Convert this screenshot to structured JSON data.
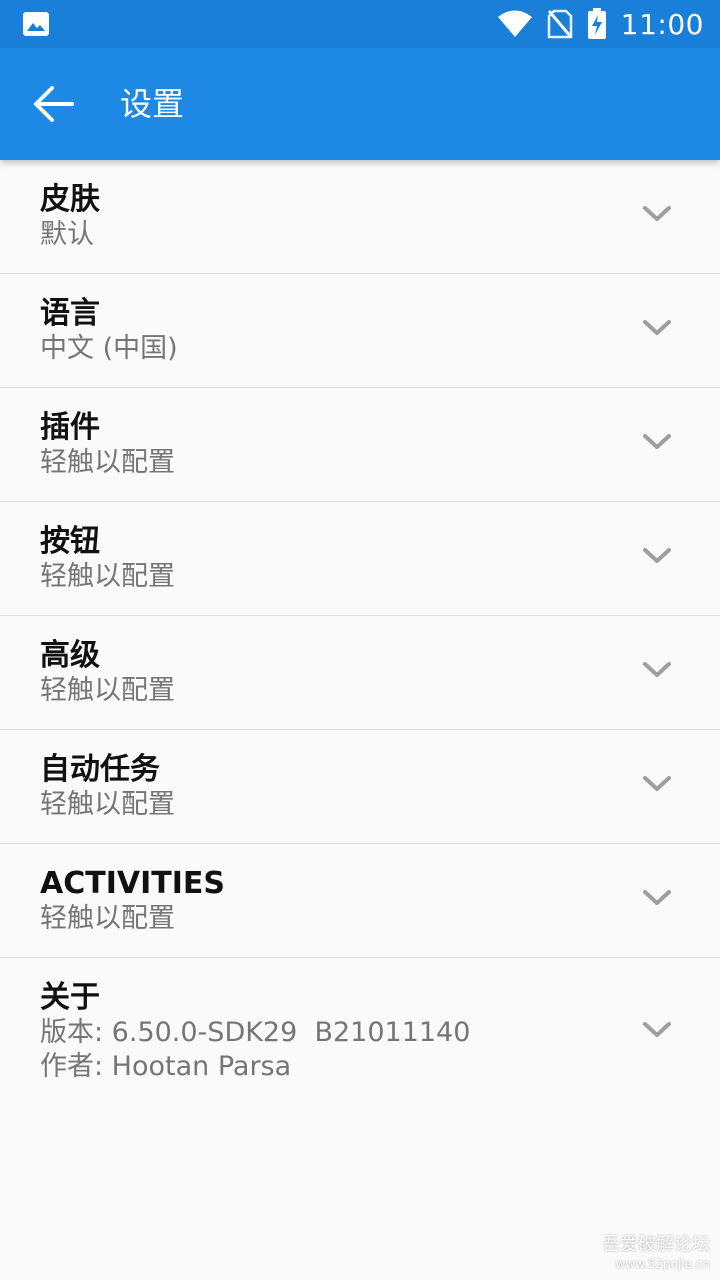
{
  "status_bar": {
    "time": "11:00",
    "icons": [
      "image-icon",
      "wifi-icon",
      "no-sim-icon",
      "battery-charging-icon"
    ]
  },
  "app_bar": {
    "title": "设置",
    "back_icon": "arrow-left-icon"
  },
  "settings": [
    {
      "label": "皮肤",
      "sub": "默认"
    },
    {
      "label": "语言",
      "sub": "中文 (中国)"
    },
    {
      "label": "插件",
      "sub": "轻触以配置"
    },
    {
      "label": "按钮",
      "sub": "轻触以配置"
    },
    {
      "label": "高级",
      "sub": "轻触以配置"
    },
    {
      "label": "自动任务",
      "sub": "轻触以配置"
    },
    {
      "label": "ACTIVITIES",
      "sub": "轻触以配置"
    }
  ],
  "about": {
    "label": "关于",
    "version": "版本: 6.50.0-SDK29  B21011140",
    "author": "作者: Hootan Parsa"
  },
  "watermark": {
    "line1": "吾爱破解论坛",
    "line2": "www.52pojie.cn"
  },
  "colors": {
    "status_bar": "#1a7fd9",
    "app_bar": "#1e88e5",
    "background": "#fafafa",
    "divider": "#e0e0e0"
  }
}
